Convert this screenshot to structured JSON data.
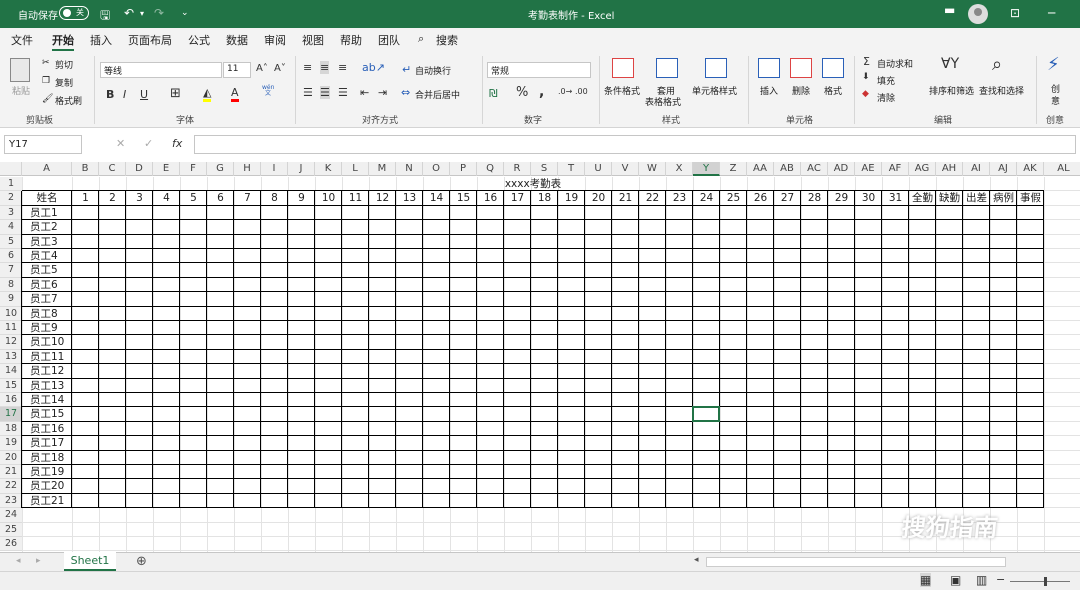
{
  "title_bar": {
    "autosave_label": "自动保存",
    "autosave_state": "关",
    "doc_title": "考勤表制作  -  Excel"
  },
  "menu": [
    "文件",
    "开始",
    "插入",
    "页面布局",
    "公式",
    "数据",
    "审阅",
    "视图",
    "帮助",
    "团队",
    "搜索"
  ],
  "ribbon": {
    "clipboard": {
      "paste": "粘贴",
      "cut": "剪切",
      "copy": "复制",
      "format_painter": "格式刷",
      "label": "剪贴板"
    },
    "font": {
      "name": "等线",
      "size": "11",
      "bold": "B",
      "italic": "I",
      "underline": "U",
      "label": "字体",
      "wen": "wén 文"
    },
    "align": {
      "wrap": "自动换行",
      "merge": "合并后居中",
      "label": "对齐方式"
    },
    "number": {
      "format": "常规",
      "percent": "%",
      "comma": ",",
      "label": "数字"
    },
    "styles": {
      "conditional": "条件格式",
      "table_line1": "套用",
      "table_line2": "表格格式",
      "cell_styles": "单元格样式",
      "label": "样式"
    },
    "cells": {
      "insert": "插入",
      "delete": "删除",
      "format": "格式",
      "label": "单元格"
    },
    "editing": {
      "autosum": "自动求和",
      "fill": "填充",
      "clear": "清除",
      "sort": "排序和筛选",
      "find": "查找和选择",
      "label": "编辑"
    },
    "ideas": {
      "line1": "创",
      "line2": "意",
      "label": "创意"
    }
  },
  "formula_bar": {
    "name_box": "Y17",
    "fx": "fx",
    "value": ""
  },
  "columns": [
    "A",
    "B",
    "C",
    "D",
    "E",
    "F",
    "G",
    "H",
    "I",
    "J",
    "K",
    "L",
    "M",
    "N",
    "O",
    "P",
    "Q",
    "R",
    "S",
    "T",
    "U",
    "V",
    "W",
    "X",
    "Y",
    "Z",
    "AA",
    "AB",
    "AC",
    "AD",
    "AE",
    "AF",
    "AG",
    "AH",
    "AI",
    "AJ",
    "AK",
    "AL"
  ],
  "selected_column": "Y",
  "selected_row": 17,
  "row_count": 26,
  "sheet": {
    "title": "xxxx考勤表",
    "header": [
      "姓名",
      "1",
      "2",
      "3",
      "4",
      "5",
      "6",
      "7",
      "8",
      "9",
      "10",
      "11",
      "12",
      "13",
      "14",
      "15",
      "16",
      "17",
      "18",
      "19",
      "20",
      "21",
      "22",
      "23",
      "24",
      "25",
      "26",
      "27",
      "28",
      "29",
      "30",
      "31",
      "全勤",
      "缺勤",
      "出差",
      "病例",
      "事假"
    ],
    "employees": [
      "员工1",
      "员工2",
      "员工3",
      "员工4",
      "员工5",
      "员工6",
      "员工7",
      "员工8",
      "员工9",
      "员工10",
      "员工11",
      "员工12",
      "员工13",
      "员工14",
      "员工15",
      "员工16",
      "员工17",
      "员工18",
      "员工19",
      "员工20",
      "员工21"
    ]
  },
  "sheet_tabs": [
    "Sheet1"
  ],
  "watermark": "搜狗指南"
}
